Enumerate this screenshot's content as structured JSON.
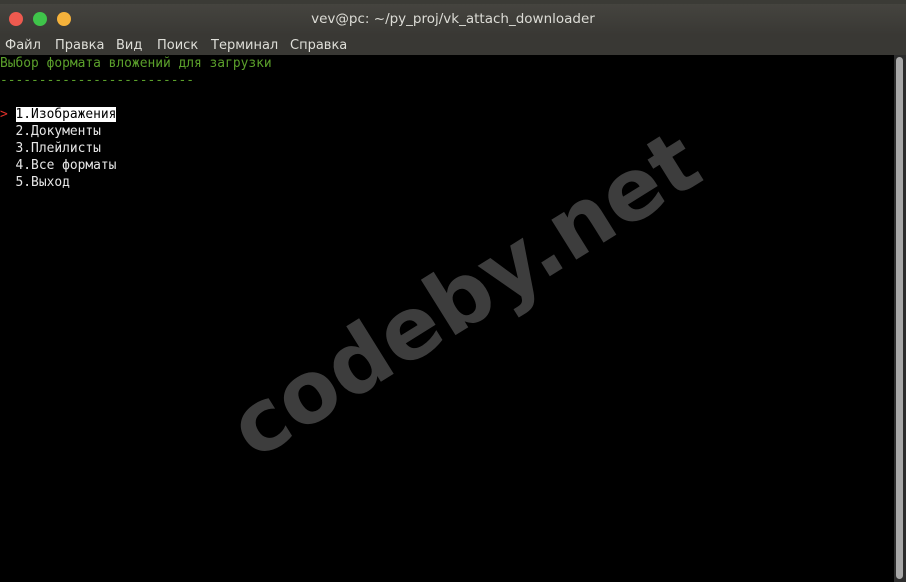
{
  "window": {
    "title": "vev@pc: ~/py_proj/vk_attach_downloader"
  },
  "menu": [
    "Файл",
    "Правка",
    "Вид",
    "Поиск",
    "Терминал",
    "Справка"
  ],
  "terminal": {
    "heading": "Выбор формата вложений для загрузки",
    "separator": "-------------------------",
    "cursor": ">",
    "options": [
      "1.Изображения",
      "2.Документы",
      "3.Плейлисты",
      "4.Все форматы",
      "5.Выход"
    ],
    "selected_index": 0
  },
  "watermark": "codeby.net",
  "colors": {
    "heading": "#5ba02b",
    "cursor": "#e0302a",
    "titlebar": "#3d3c38",
    "selected_bg": "#ffffff"
  }
}
